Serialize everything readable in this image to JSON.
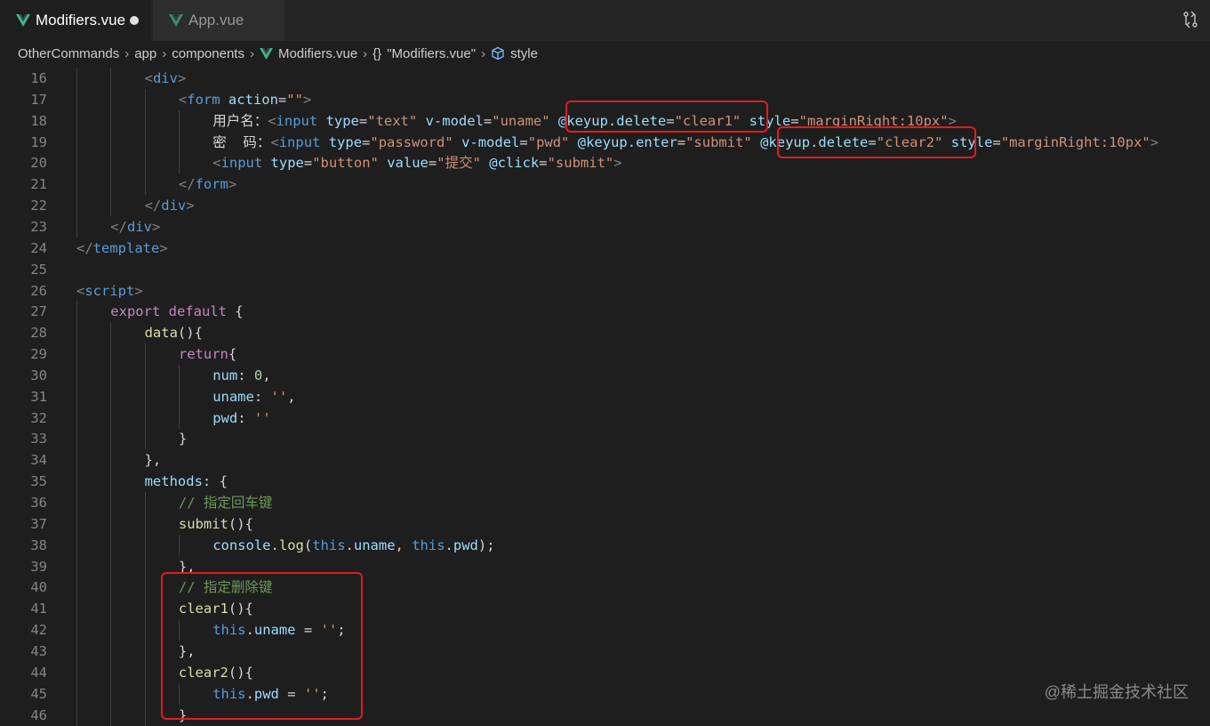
{
  "tabs": [
    {
      "label": "Modifiers.vue",
      "modified": true,
      "active": true
    },
    {
      "label": "App.vue",
      "modified": false,
      "active": false
    }
  ],
  "breadcrumb": [
    "OtherCommands",
    "app",
    "components",
    "Modifiers.vue",
    "\"Modifiers.vue\"",
    "style"
  ],
  "watermark": "@稀土掘金技术社区",
  "colors": {
    "highlight_box": "#e11d1d",
    "editor_bg": "#1e1e1e"
  },
  "lines": [
    {
      "n": "16",
      "indent": 2,
      "tokens": [
        [
          "t-punct",
          "<"
        ],
        [
          "t-tag",
          "div"
        ],
        [
          "t-punct",
          ">"
        ]
      ]
    },
    {
      "n": "17",
      "indent": 3,
      "tokens": [
        [
          "t-punct",
          "<"
        ],
        [
          "t-tag",
          "form"
        ],
        [
          "t-text",
          " "
        ],
        [
          "t-attr",
          "action"
        ],
        [
          "t-text",
          "="
        ],
        [
          "t-str",
          "\"\""
        ],
        [
          "t-punct",
          ">"
        ]
      ]
    },
    {
      "n": "18",
      "indent": 4,
      "tokens": [
        [
          "t-text",
          "用户名："
        ],
        [
          "t-punct",
          "<"
        ],
        [
          "t-tag",
          "input"
        ],
        [
          "t-text",
          " "
        ],
        [
          "t-attr",
          "type"
        ],
        [
          "t-text",
          "="
        ],
        [
          "t-str",
          "\"text\""
        ],
        [
          "t-text",
          " "
        ],
        [
          "t-attr",
          "v-model"
        ],
        [
          "t-text",
          "="
        ],
        [
          "t-str",
          "\"uname\""
        ],
        [
          "t-text",
          " "
        ],
        [
          "t-attr",
          "@keyup.delete"
        ],
        [
          "t-text",
          "="
        ],
        [
          "t-str",
          "\"clear1\""
        ],
        [
          "t-text",
          " "
        ],
        [
          "t-attr",
          "style"
        ],
        [
          "t-text",
          "="
        ],
        [
          "t-str",
          "\"marginRight:10px\""
        ],
        [
          "t-punct",
          ">"
        ]
      ]
    },
    {
      "n": "19",
      "indent": 4,
      "tokens": [
        [
          "t-text",
          "密  码："
        ],
        [
          "t-punct",
          "<"
        ],
        [
          "t-tag",
          "input"
        ],
        [
          "t-text",
          " "
        ],
        [
          "t-attr",
          "type"
        ],
        [
          "t-text",
          "="
        ],
        [
          "t-str",
          "\"password\""
        ],
        [
          "t-text",
          " "
        ],
        [
          "t-attr",
          "v-model"
        ],
        [
          "t-text",
          "="
        ],
        [
          "t-str",
          "\"pwd\""
        ],
        [
          "t-text",
          " "
        ],
        [
          "t-attr",
          "@keyup.enter"
        ],
        [
          "t-text",
          "="
        ],
        [
          "t-str",
          "\"submit\""
        ],
        [
          "t-text",
          " "
        ],
        [
          "t-attr",
          "@keyup.delete"
        ],
        [
          "t-text",
          "="
        ],
        [
          "t-str",
          "\"clear2\""
        ],
        [
          "t-text",
          " "
        ],
        [
          "t-attr",
          "style"
        ],
        [
          "t-text",
          "="
        ],
        [
          "t-str",
          "\"marginRight:10px\""
        ],
        [
          "t-punct",
          ">"
        ]
      ]
    },
    {
      "n": "20",
      "indent": 4,
      "tokens": [
        [
          "t-punct",
          "<"
        ],
        [
          "t-tag",
          "input"
        ],
        [
          "t-text",
          " "
        ],
        [
          "t-attr",
          "type"
        ],
        [
          "t-text",
          "="
        ],
        [
          "t-str",
          "\"button\""
        ],
        [
          "t-text",
          " "
        ],
        [
          "t-attr",
          "value"
        ],
        [
          "t-text",
          "="
        ],
        [
          "t-str",
          "\"提交\""
        ],
        [
          "t-text",
          " "
        ],
        [
          "t-attr",
          "@click"
        ],
        [
          "t-text",
          "="
        ],
        [
          "t-str",
          "\"submit\""
        ],
        [
          "t-punct",
          ">"
        ]
      ]
    },
    {
      "n": "21",
      "indent": 3,
      "tokens": [
        [
          "t-punct",
          "</"
        ],
        [
          "t-tag",
          "form"
        ],
        [
          "t-punct",
          ">"
        ]
      ]
    },
    {
      "n": "22",
      "indent": 2,
      "tokens": [
        [
          "t-punct",
          "</"
        ],
        [
          "t-tag",
          "div"
        ],
        [
          "t-punct",
          ">"
        ]
      ]
    },
    {
      "n": "23",
      "indent": 1,
      "tokens": [
        [
          "t-punct",
          "</"
        ],
        [
          "t-tag",
          "div"
        ],
        [
          "t-punct",
          ">"
        ]
      ]
    },
    {
      "n": "24",
      "indent": 0,
      "tokens": [
        [
          "t-punct",
          "</"
        ],
        [
          "t-tag",
          "template"
        ],
        [
          "t-punct",
          ">"
        ]
      ]
    },
    {
      "n": "25",
      "indent": 0,
      "tokens": []
    },
    {
      "n": "26",
      "indent": 0,
      "tokens": [
        [
          "t-punct",
          "<"
        ],
        [
          "t-tag",
          "script"
        ],
        [
          "t-punct",
          ">"
        ]
      ]
    },
    {
      "n": "27",
      "indent": 1,
      "tokens": [
        [
          "t-kw",
          "export"
        ],
        [
          "t-text",
          " "
        ],
        [
          "t-kw",
          "default"
        ],
        [
          "t-text",
          " {"
        ]
      ]
    },
    {
      "n": "28",
      "indent": 2,
      "tokens": [
        [
          "t-fn",
          "data"
        ],
        [
          "t-text",
          "(){"
        ]
      ]
    },
    {
      "n": "29",
      "indent": 3,
      "tokens": [
        [
          "t-kw",
          "return"
        ],
        [
          "t-text",
          "{"
        ]
      ]
    },
    {
      "n": "30",
      "indent": 4,
      "tokens": [
        [
          "t-attr",
          "num"
        ],
        [
          "t-text",
          ": "
        ],
        [
          "t-num",
          "0"
        ],
        [
          "t-text",
          ","
        ]
      ]
    },
    {
      "n": "31",
      "indent": 4,
      "tokens": [
        [
          "t-attr",
          "uname"
        ],
        [
          "t-text",
          ": "
        ],
        [
          "t-str",
          "''"
        ],
        [
          "t-text",
          ","
        ]
      ]
    },
    {
      "n": "32",
      "indent": 4,
      "tokens": [
        [
          "t-attr",
          "pwd"
        ],
        [
          "t-text",
          ": "
        ],
        [
          "t-str",
          "''"
        ]
      ]
    },
    {
      "n": "33",
      "indent": 3,
      "tokens": [
        [
          "t-text",
          "}"
        ]
      ]
    },
    {
      "n": "34",
      "indent": 2,
      "tokens": [
        [
          "t-text",
          "},"
        ]
      ]
    },
    {
      "n": "35",
      "indent": 2,
      "tokens": [
        [
          "t-attr",
          "methods"
        ],
        [
          "t-text",
          ": {"
        ]
      ]
    },
    {
      "n": "36",
      "indent": 3,
      "tokens": [
        [
          "t-cm",
          "// 指定回车键"
        ]
      ]
    },
    {
      "n": "37",
      "indent": 3,
      "tokens": [
        [
          "t-fn",
          "submit"
        ],
        [
          "t-text",
          "(){"
        ]
      ]
    },
    {
      "n": "38",
      "indent": 4,
      "tokens": [
        [
          "t-attr",
          "console"
        ],
        [
          "t-text",
          "."
        ],
        [
          "t-fn",
          "log"
        ],
        [
          "t-text",
          "("
        ],
        [
          "t-this",
          "this"
        ],
        [
          "t-text",
          "."
        ],
        [
          "t-attr",
          "uname"
        ],
        [
          "t-text",
          ", "
        ],
        [
          "t-this",
          "this"
        ],
        [
          "t-text",
          "."
        ],
        [
          "t-attr",
          "pwd"
        ],
        [
          "t-text",
          ");"
        ]
      ]
    },
    {
      "n": "39",
      "indent": 3,
      "tokens": [
        [
          "t-text",
          "},"
        ]
      ]
    },
    {
      "n": "40",
      "indent": 3,
      "tokens": [
        [
          "t-cm",
          "// 指定删除键"
        ]
      ]
    },
    {
      "n": "41",
      "indent": 3,
      "tokens": [
        [
          "t-fn",
          "clear1"
        ],
        [
          "t-text",
          "(){"
        ]
      ]
    },
    {
      "n": "42",
      "indent": 4,
      "tokens": [
        [
          "t-this",
          "this"
        ],
        [
          "t-text",
          "."
        ],
        [
          "t-attr",
          "uname"
        ],
        [
          "t-text",
          " = "
        ],
        [
          "t-str",
          "''"
        ],
        [
          "t-text",
          ";"
        ]
      ]
    },
    {
      "n": "43",
      "indent": 3,
      "tokens": [
        [
          "t-text",
          "},"
        ]
      ]
    },
    {
      "n": "44",
      "indent": 3,
      "tokens": [
        [
          "t-fn",
          "clear2"
        ],
        [
          "t-text",
          "(){"
        ]
      ]
    },
    {
      "n": "45",
      "indent": 4,
      "tokens": [
        [
          "t-this",
          "this"
        ],
        [
          "t-text",
          "."
        ],
        [
          "t-attr",
          "pwd"
        ],
        [
          "t-text",
          " = "
        ],
        [
          "t-str",
          "''"
        ],
        [
          "t-text",
          ";"
        ]
      ]
    },
    {
      "n": "46",
      "indent": 3,
      "tokens": [
        [
          "t-text",
          "}"
        ]
      ]
    }
  ]
}
